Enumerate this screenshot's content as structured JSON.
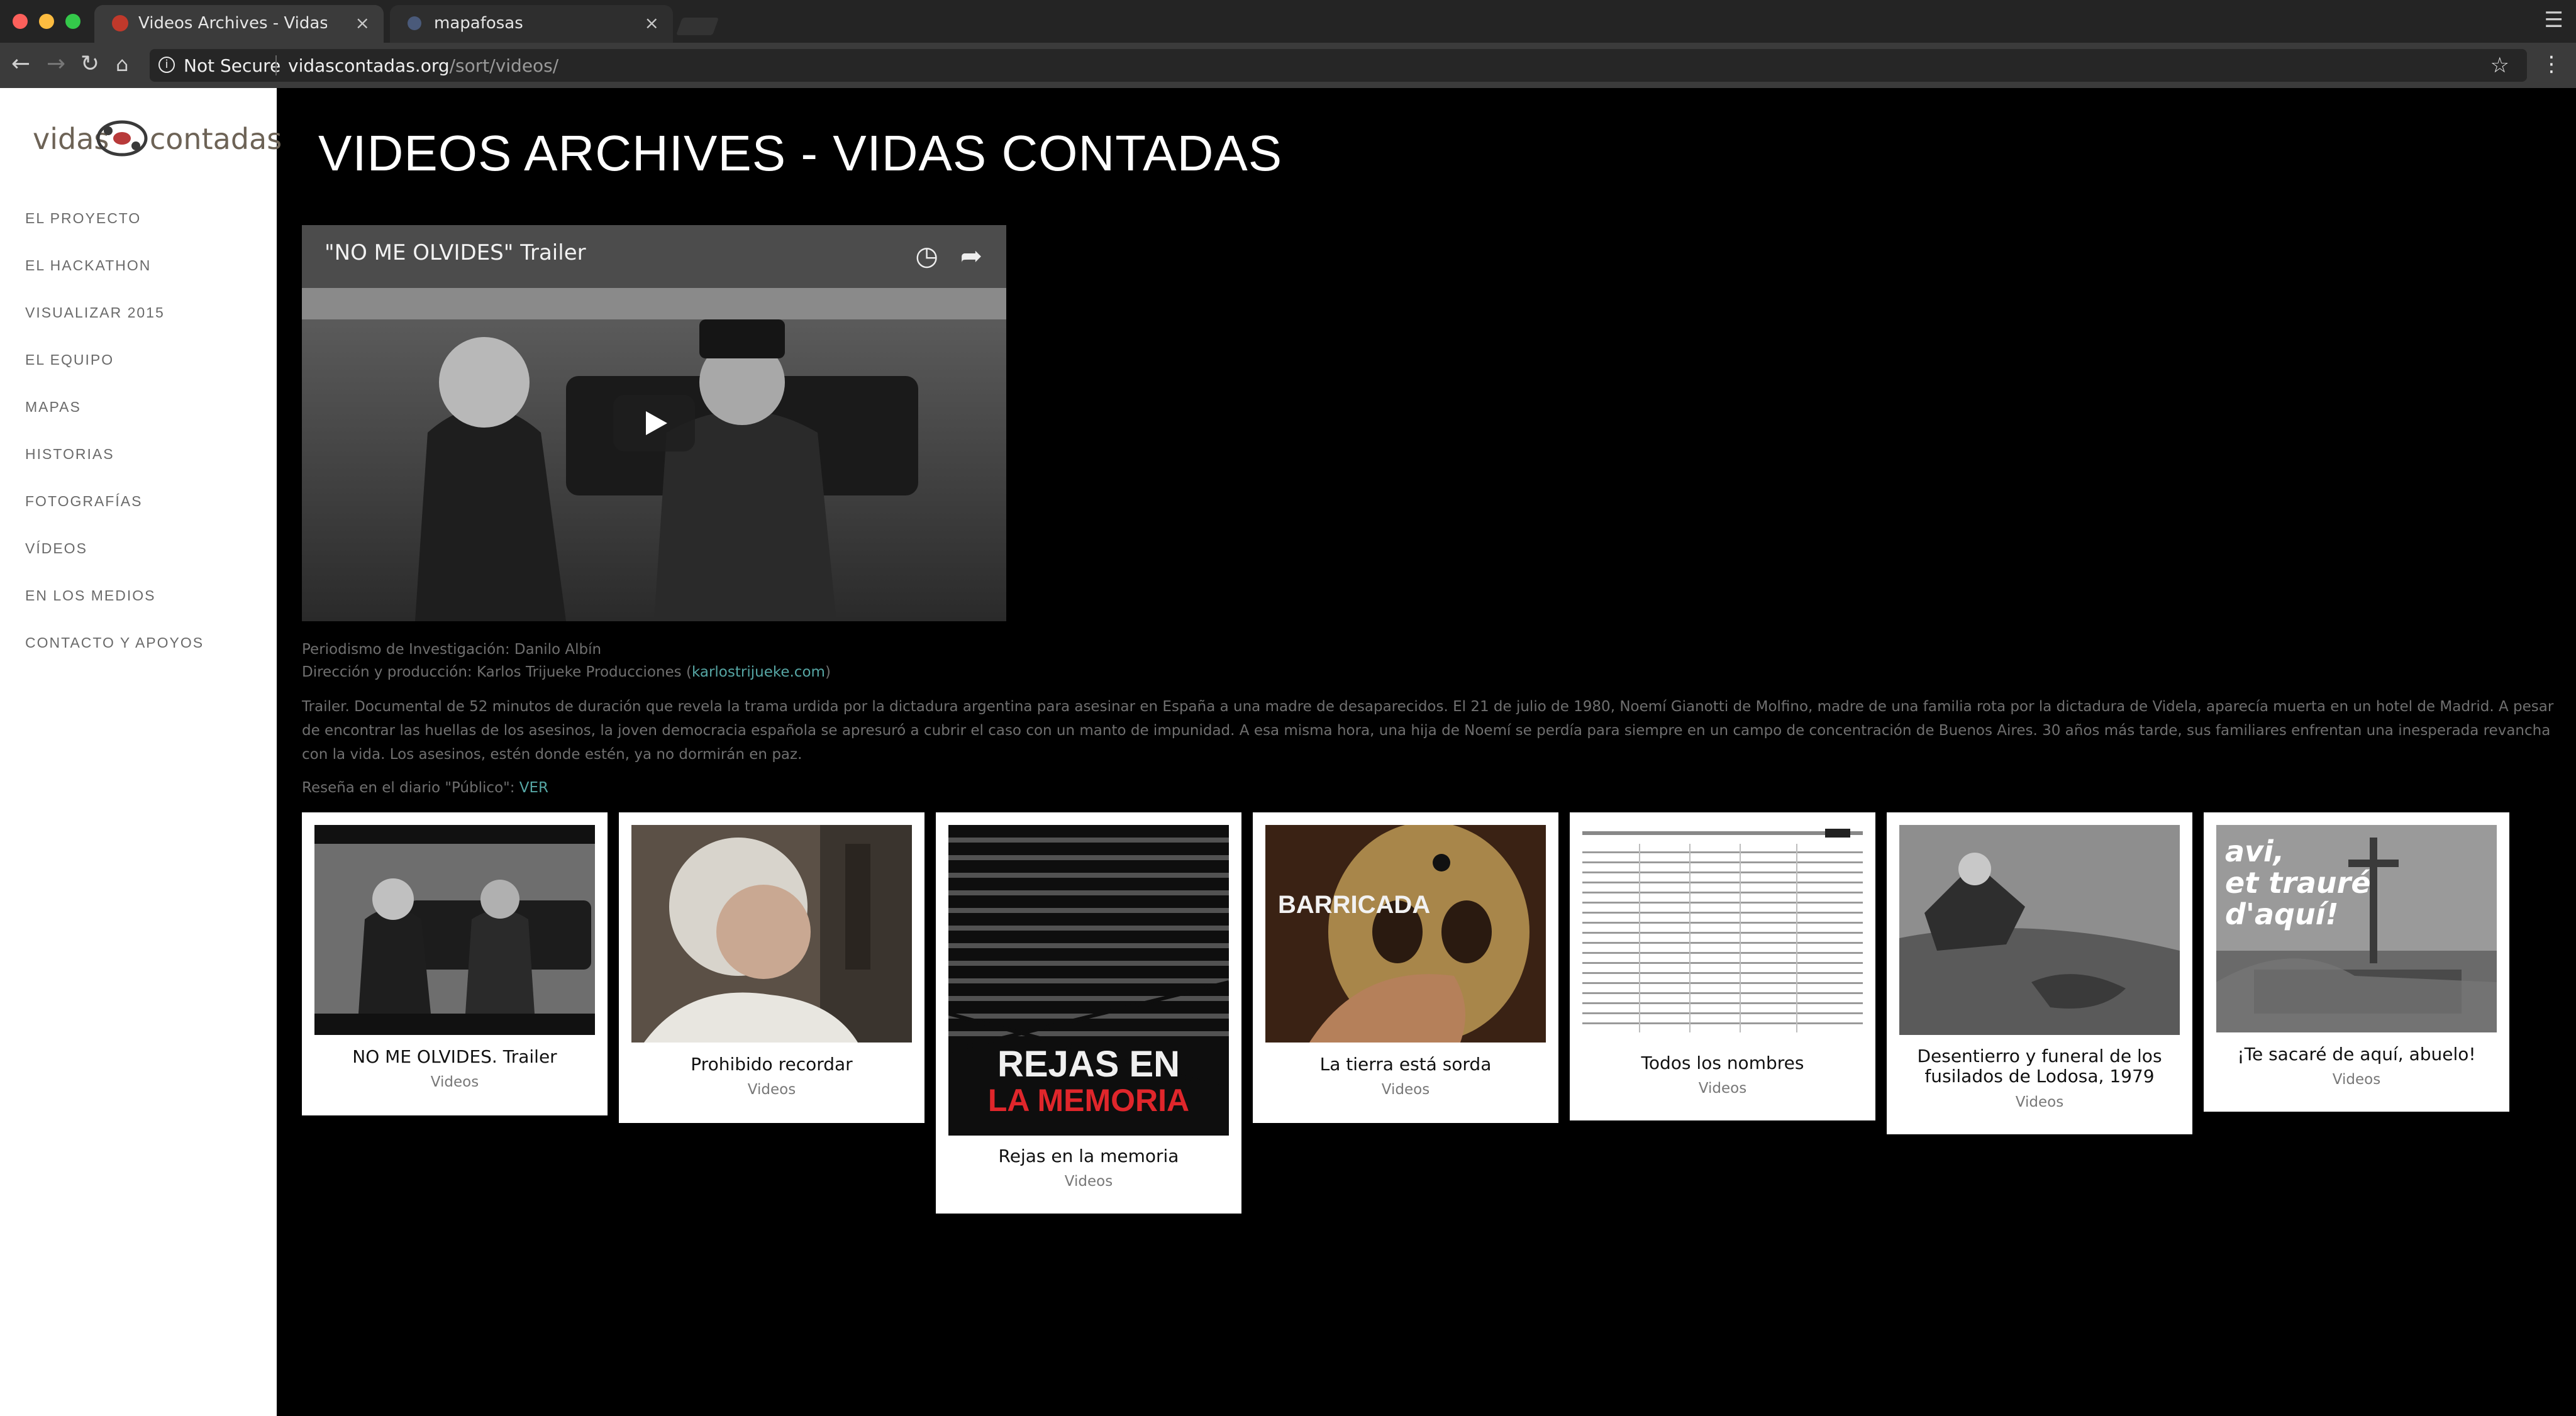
{
  "browser": {
    "tabs": [
      {
        "title": "Videos Archives - Vidas conta",
        "active": true
      },
      {
        "title": "mapafosas",
        "active": false
      }
    ],
    "omnibox": {
      "security": "Not Secure",
      "host": "vidascontadas.org",
      "path": "/sort/videos/"
    }
  },
  "sidebar": {
    "logo": {
      "left": "vidas",
      "right": "contadas"
    },
    "menu": [
      "EL PROYECTO",
      "EL HACKATHON",
      "VISUALIZAR 2015",
      "EL EQUIPO",
      "MAPAS",
      "HISTORIAS",
      "FOTOGRAFÍAS",
      "VÍDEOS",
      "EN LOS MEDIOS",
      "CONTACTO Y APOYOS"
    ]
  },
  "main": {
    "page_title": "VIDEOS ARCHIVES - VIDAS CONTADAS",
    "video": {
      "title": "\"NO ME OLVIDES\" Trailer"
    },
    "credits": {
      "research": "Periodismo de Investigación: Danilo Albín",
      "direction": "Dirección y producción: Karlos Trijueke Producciones (",
      "direction_link": "karlostrijueke.com",
      "direction_close": ")"
    },
    "description": "Trailer. Documental de 52 minutos de duración que revela la trama urdida por la dictadura argentina para asesinar en España a una madre de desaparecidos. El 21 de julio de 1980, Noemí Gianotti de Molfino, madre de una familia rota por la dictadura de Videla, aparecía muerta en un hotel de Madrid. A pesar de encontrar las huellas de los asesinos, la joven democracia española se apresuró a cubrir el caso con un manto de impunidad. A esa misma hora, una hija de Noemí se perdía para siempre en un campo de concentración de Buenos Aires. 30 años más tarde, sus familiares enfrentan una inesperada revancha con la vida. Los asesinos, estén donde estén, ya no dormirán en paz.",
    "review": {
      "text": "Reseña en el diario \"Público\": ",
      "link": "VER"
    },
    "cards": [
      {
        "title": "NO ME OLVIDES. Trailer",
        "category": "Videos"
      },
      {
        "title": "Prohibido recordar",
        "category": "Videos"
      },
      {
        "title": "Rejas en la memoria",
        "category": "Videos",
        "poster_line1": "REJAS EN",
        "poster_line2": "LA MEMORIA"
      },
      {
        "title": "La tierra está sorda",
        "category": "Videos",
        "poster_text": "BARRICADA"
      },
      {
        "title": "Todos los nombres",
        "category": "Videos"
      },
      {
        "title_line1": "Desentierro y funeral de los",
        "title_line2": "fusilados de Lodosa, 1979",
        "category": "Videos"
      },
      {
        "title": "¡Te sacaré de aquí, abuelo!",
        "category": "Videos",
        "poster_line1": "avi,",
        "poster_line2": "et trauré",
        "poster_line3": "d'aquí!"
      }
    ]
  }
}
